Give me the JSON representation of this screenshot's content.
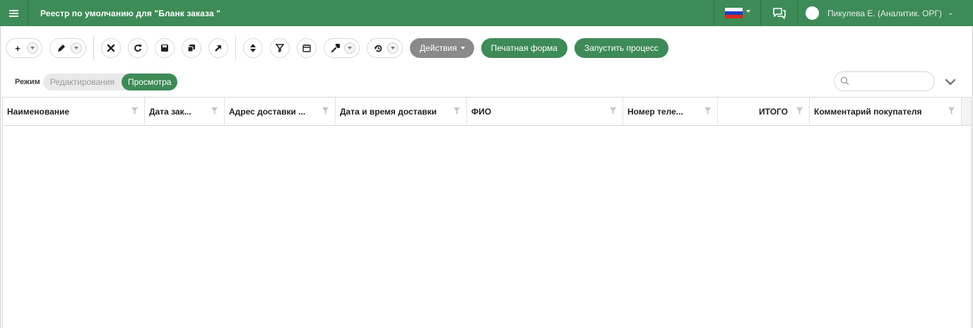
{
  "header": {
    "title": "Реестр по умолчанию для \"Бланк заказа \"",
    "language_flag": "ru-flag-icon",
    "user_name": "Пикулева Е. (Аналитик. ОРГ)",
    "accent_color": "#3d8b57"
  },
  "toolbar": {
    "add_symbol": "+",
    "actions_label": "Действия",
    "print_form_label": "Печатная форма",
    "start_process_label": "Запустить процесс",
    "icons": [
      "plus-icon",
      "pencil-icon",
      "delete-icon",
      "refresh-icon",
      "save-icon",
      "copy-icon",
      "open-external-icon",
      "sort-icon",
      "filter-icon",
      "calendar-icon",
      "wrench-icon",
      "history-icon"
    ]
  },
  "mode": {
    "label": "Режим",
    "edit_label": "Редактирования",
    "view_label": "Просмотра",
    "selected": "Просмотра"
  },
  "search": {
    "placeholder": "",
    "value": ""
  },
  "grid": {
    "columns": [
      {
        "label": "Наименование"
      },
      {
        "label": "Дата зак..."
      },
      {
        "label": "Адрес доставки ..."
      },
      {
        "label": "Дата и время доставки"
      },
      {
        "label": "ФИО"
      },
      {
        "label": "Номер теле..."
      },
      {
        "label": "ИТОГО"
      },
      {
        "label": "Комментарий покупателя"
      }
    ],
    "rows": []
  }
}
